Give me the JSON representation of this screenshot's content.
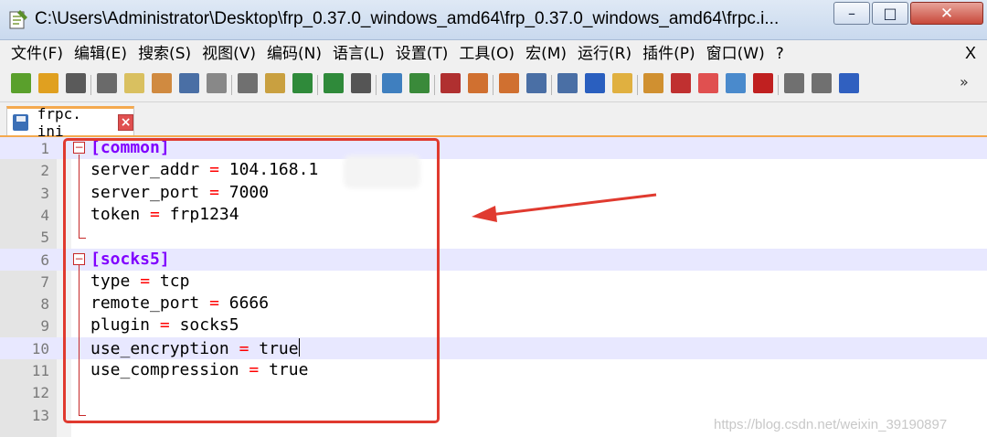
{
  "window": {
    "title": "C:\\Users\\Administrator\\Desktop\\frp_0.37.0_windows_amd64\\frp_0.37.0_windows_amd64\\frpc.i...",
    "minimize_glyph": "–",
    "maximize_glyph": "□",
    "close_glyph": "✕"
  },
  "menu": {
    "items": [
      "文件(F)",
      "编辑(E)",
      "搜索(S)",
      "视图(V)",
      "编码(N)",
      "语言(L)",
      "设置(T)",
      "工具(O)",
      "宏(M)",
      "运行(R)",
      "插件(P)",
      "窗口(W)",
      "?"
    ],
    "close_label": "X"
  },
  "toolbar": {
    "more_glyph": "»",
    "icons": [
      "new-file-icon",
      "open-file-icon",
      "save-icon",
      "save-all-icon",
      "close-icon",
      "close-all-icon",
      "print-icon",
      "cut-icon",
      "copy-icon",
      "paste-icon",
      "undo-icon",
      "redo-icon",
      "find-icon",
      "replace-icon",
      "zoom-in-icon",
      "zoom-out-icon",
      "sync-vertical-icon",
      "sync-horizontal-icon",
      "word-wrap-icon",
      "show-all-chars-icon",
      "indent-guide-icon",
      "lang-udl-icon",
      "doc-map-icon",
      "function-list-icon",
      "folder-workspace-icon",
      "monitoring-icon",
      "record-macro-icon",
      "stop-record-icon",
      "play-macro-icon",
      "run-macro-multiple-icon"
    ]
  },
  "tab": {
    "label": "frpc. ini"
  },
  "editor": {
    "lines": [
      {
        "num": "1",
        "section": "[common]"
      },
      {
        "num": "2",
        "key": "server_addr",
        "eq": "=",
        "value": "104.168.1"
      },
      {
        "num": "3",
        "key": "server_port",
        "eq": "=",
        "value": "7000"
      },
      {
        "num": "4",
        "key": "token",
        "eq": "=",
        "value": "frp1234"
      },
      {
        "num": "5"
      },
      {
        "num": "6",
        "section": "[socks5]"
      },
      {
        "num": "7",
        "key": "type",
        "eq": "=",
        "value": "tcp"
      },
      {
        "num": "8",
        "key": "remote_port",
        "eq": "=",
        "value": "6666"
      },
      {
        "num": "9",
        "key": "plugin",
        "eq": "=",
        "value": "socks5"
      },
      {
        "num": "10",
        "key": "use_encryption",
        "eq": "=",
        "value": "true"
      },
      {
        "num": "11",
        "key": "use_compression",
        "eq": "=",
        "value": "true"
      },
      {
        "num": "12"
      },
      {
        "num": "13"
      }
    ]
  },
  "colors": {
    "section": "#8000ff",
    "operator": "#ff0000",
    "annotation": "#e03a2f",
    "current_line": "#e8e8ff"
  },
  "watermark": "https://blog.csdn.net/weixin_39190897"
}
